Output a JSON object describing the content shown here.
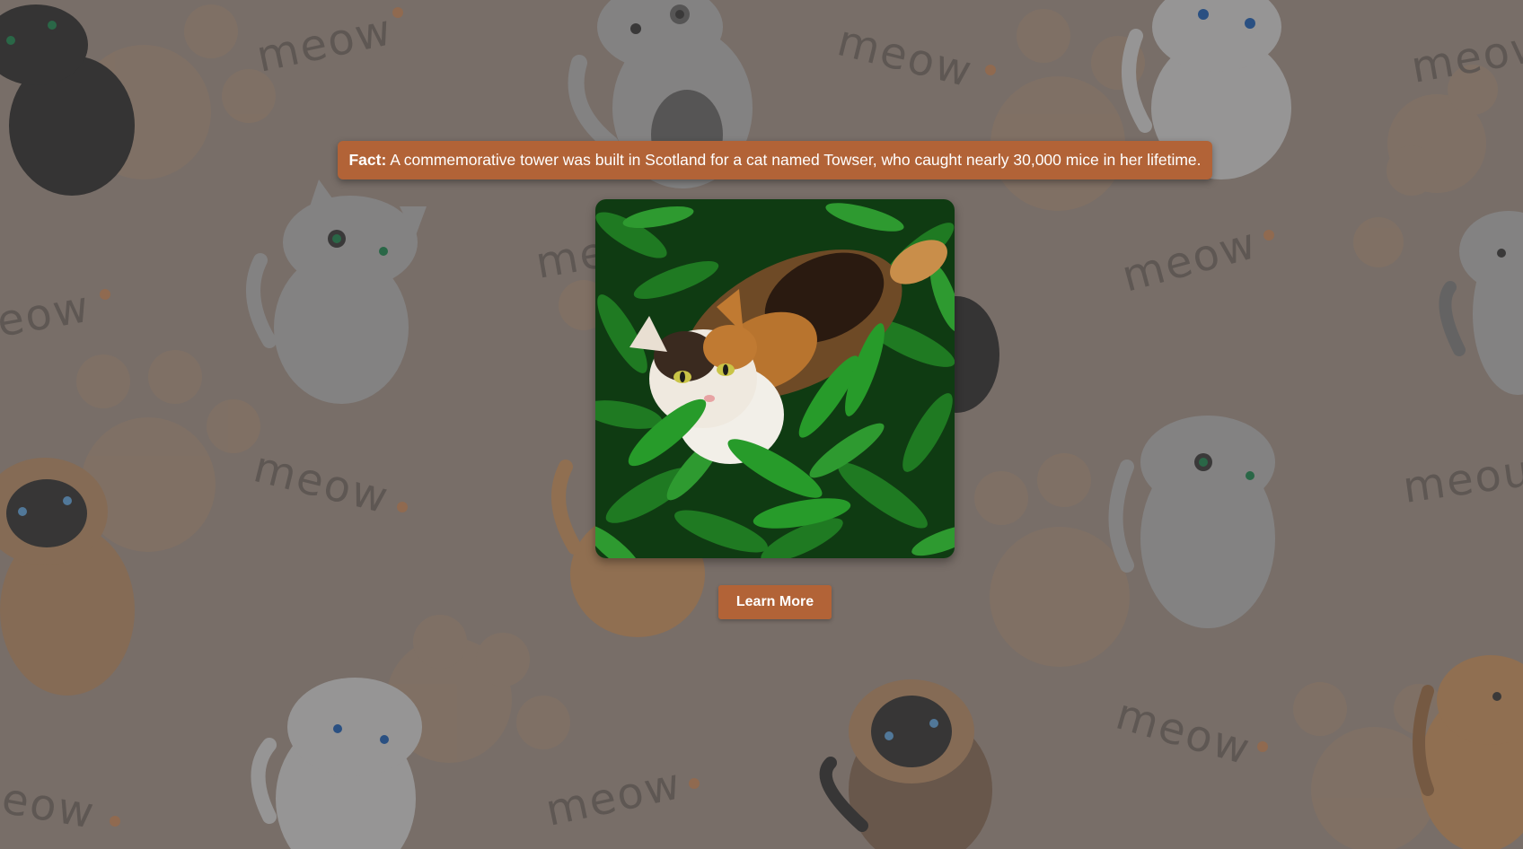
{
  "fact": {
    "label": "Fact:",
    "text": " A commemorative tower was built in Scotland for a cat named Towser, who caught nearly 30,000 mice in her lifetime."
  },
  "photo": {
    "alt": "Calico cat sitting in green leaves"
  },
  "actions": {
    "learn_more_label": "Learn More"
  },
  "background": {
    "meow_word": "meow"
  },
  "colors": {
    "accent": "#b26337",
    "background": "#7e736c",
    "button_text": "#ffffff"
  }
}
